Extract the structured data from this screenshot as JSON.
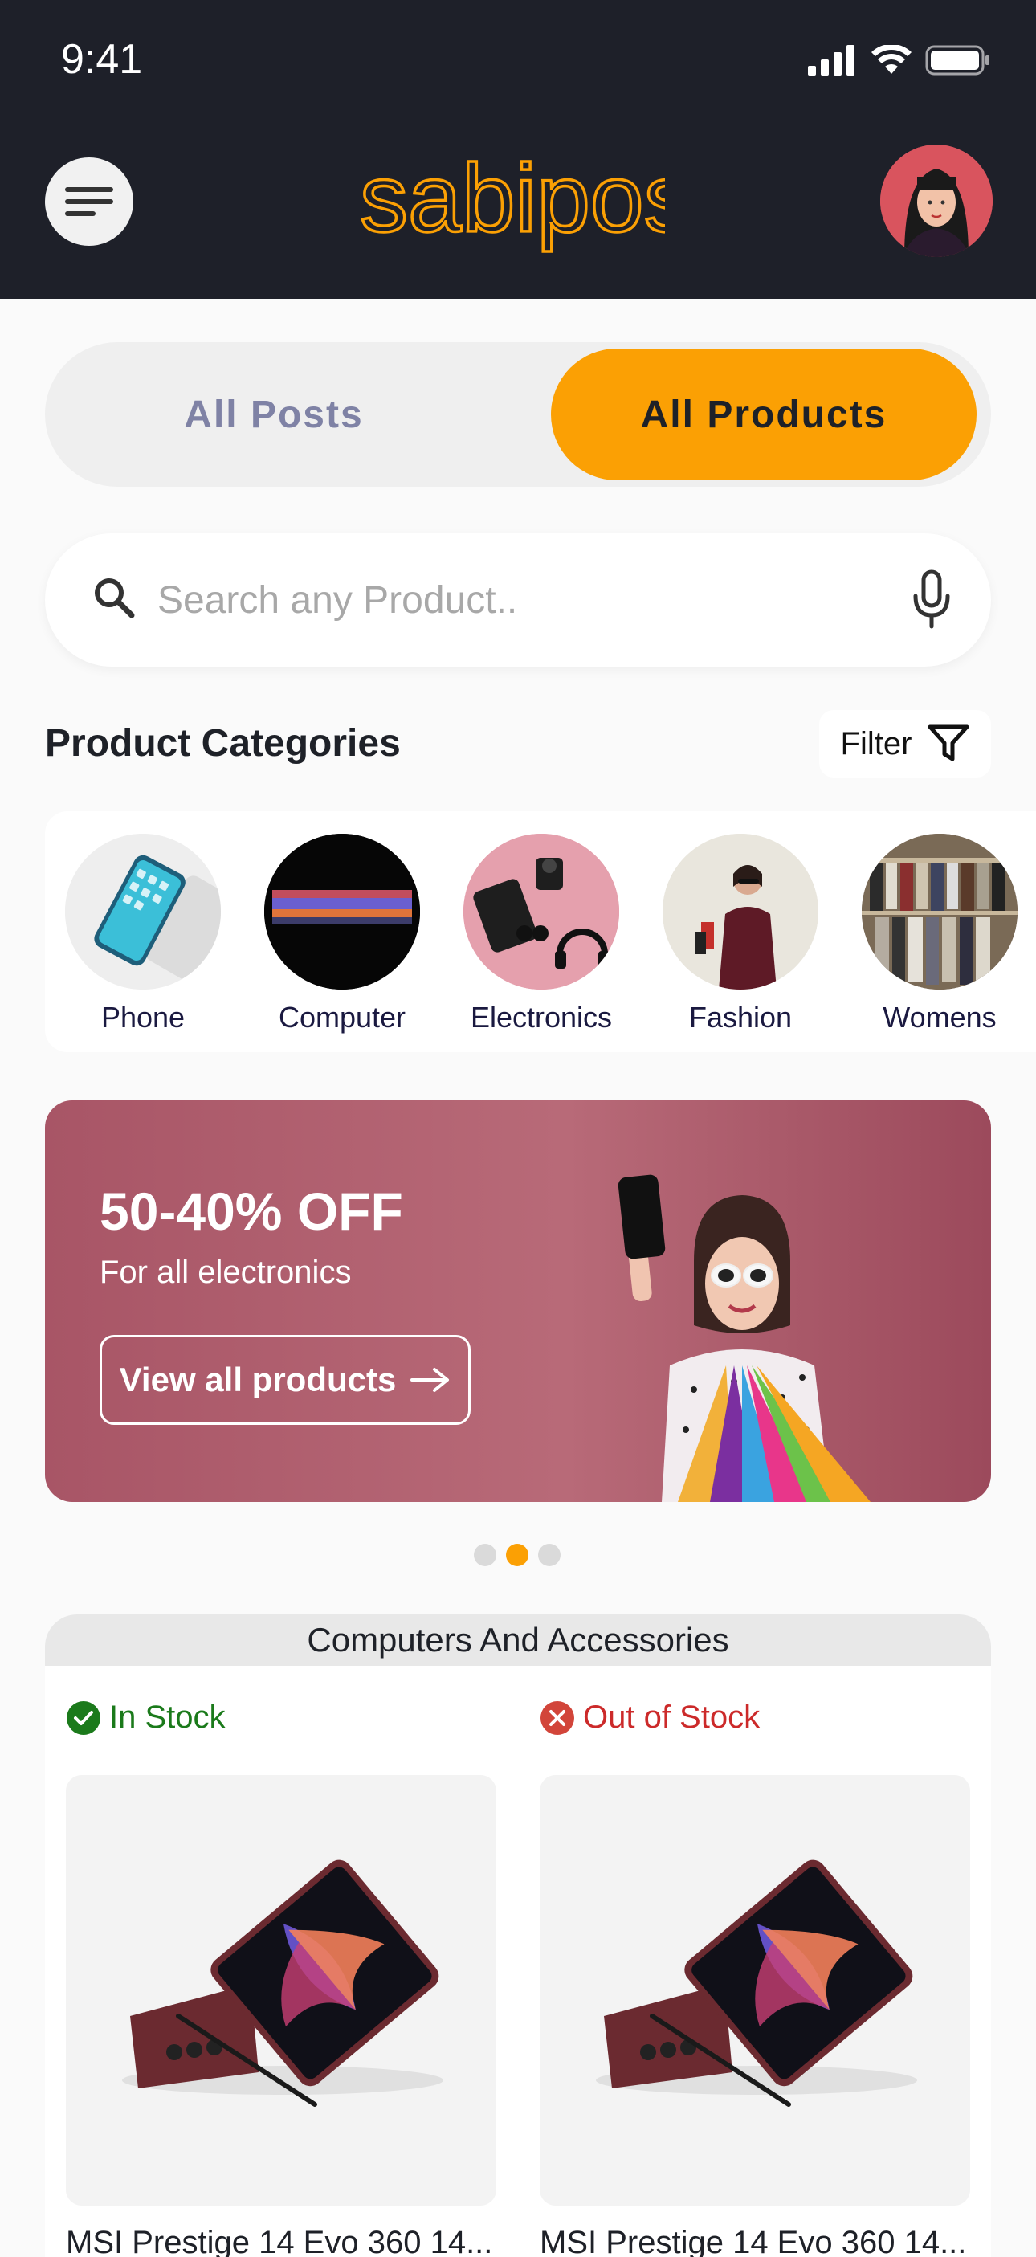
{
  "status_bar": {
    "time": "9:41"
  },
  "header": {
    "logo_text": "sabipost",
    "brand_color": "#fba004"
  },
  "tabs": [
    {
      "label": "All Posts",
      "active": false
    },
    {
      "label": "All Products",
      "active": true
    }
  ],
  "search": {
    "placeholder": "Search any Product..",
    "value": ""
  },
  "categories_section": {
    "title": "Product Categories",
    "filter_label": "Filter",
    "items": [
      {
        "label": "Phone",
        "icon": "phone-image"
      },
      {
        "label": "Computer",
        "icon": "computer-image"
      },
      {
        "label": "Electronics",
        "icon": "electronics-image"
      },
      {
        "label": "Fashion",
        "icon": "fashion-image"
      },
      {
        "label": "Womens",
        "icon": "womens-image"
      }
    ]
  },
  "banner": {
    "title": "50-40% OFF",
    "subtitle": "For all electronics",
    "button_label": "View all products",
    "carousel_active_index": 1,
    "carousel_count": 3
  },
  "products_section": {
    "title": "Computers And Accessories",
    "items": [
      {
        "stock": "In Stock",
        "in_stock": true,
        "name": "MSI Prestige 14 Evo 360 14..."
      },
      {
        "stock": "Out of Stock",
        "in_stock": false,
        "name": "MSI Prestige 14 Evo 360 14..."
      }
    ]
  }
}
